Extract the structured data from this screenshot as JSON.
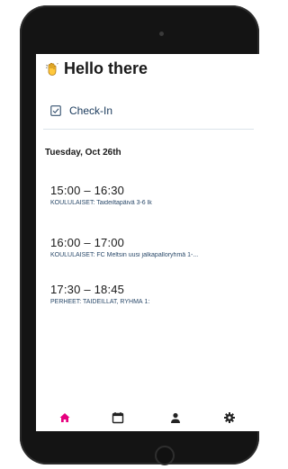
{
  "greeting": "Hello there",
  "checkin_label": "Check-In",
  "date_label": "Tuesday, Oct 26th",
  "events": [
    {
      "time": "15:00 – 16:30",
      "description": "KOULULAISET: Taideiltapäivä 3-6 lk"
    },
    {
      "time": "16:00 – 17:00",
      "description": "KOULULAISET: FC Meltsin uusi jalkapalloryhmä 1-..."
    },
    {
      "time": "17:30 – 18:45",
      "description": "PERHEET: TAIDEILLAT, RYHMÄ 1:"
    }
  ],
  "tabs": [
    {
      "name": "tab-home",
      "icon": "home-icon",
      "active": true
    },
    {
      "name": "tab-calendar",
      "icon": "calendar-icon",
      "active": false
    },
    {
      "name": "tab-profile",
      "icon": "person-icon",
      "active": false
    },
    {
      "name": "tab-settings",
      "icon": "gear-icon",
      "active": false
    }
  ],
  "colors": {
    "accent": "#e6007e",
    "icon": "#222222",
    "checkin": "#1a3a5c"
  }
}
